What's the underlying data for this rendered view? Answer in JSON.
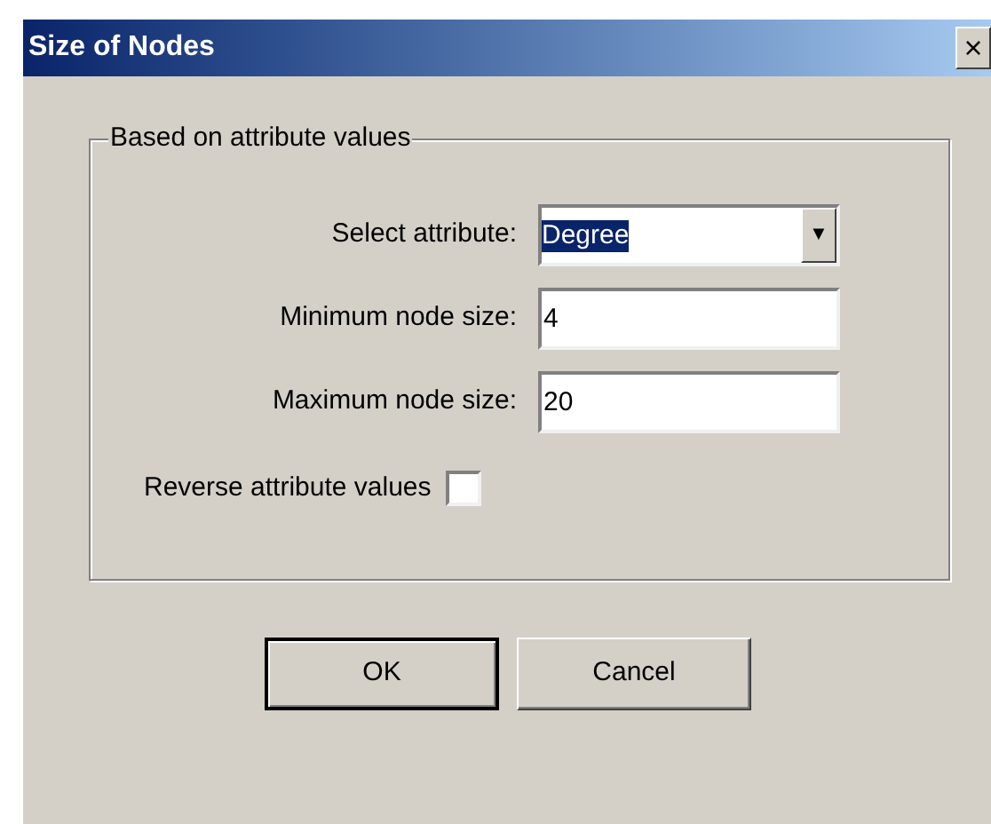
{
  "window": {
    "title": "Size of Nodes",
    "close": "×"
  },
  "group": {
    "legend": "Based on attribute values",
    "fields": [
      {
        "kind": "combo",
        "label": "Select attribute:",
        "value": "Degree",
        "text_selected": true,
        "arrow": "▼"
      },
      {
        "kind": "text",
        "label": "Minimum node size:",
        "value": "4"
      },
      {
        "kind": "text",
        "label": "Maximum node size:",
        "value": "20"
      }
    ],
    "checkbox": {
      "label": "Reverse attribute values",
      "checked": false
    }
  },
  "buttons": [
    {
      "label": "OK",
      "default": true
    },
    {
      "label": "Cancel",
      "default": false
    }
  ]
}
